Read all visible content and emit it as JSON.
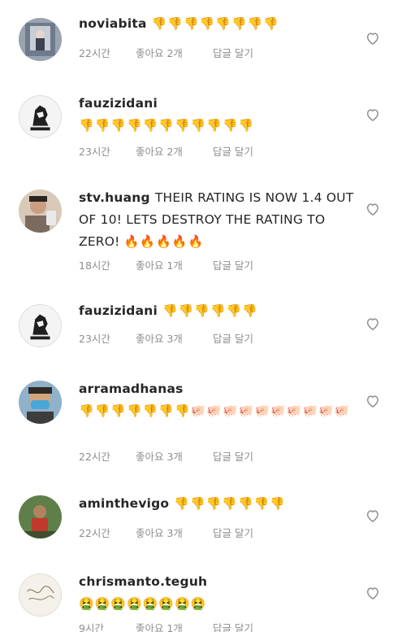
{
  "colors": {
    "text": "#262626",
    "meta": "#8e8e8e",
    "heart": "#8e8e8e"
  },
  "comments": [
    {
      "username": "noviabita",
      "text": "",
      "emoji": "👎👎👎👎👎👎👎👎",
      "time": "22시간",
      "likes": "좋아요 2개",
      "reply": "답글 달기"
    },
    {
      "username": "fauzizidani",
      "text": "",
      "emoji": "👎👎👎👎👎👎👎👎👎👎👎",
      "time": "23시간",
      "likes": "좋아요 2개",
      "reply": "답글 달기"
    },
    {
      "username": "stv.huang",
      "text": "THEIR RATING IS NOW 1.4 OUT OF 10! LETS DESTROY THE RATING TO ZERO!",
      "emoji": "🔥🔥🔥🔥🔥",
      "time": "18시간",
      "likes": "좋아요 1개",
      "reply": "답글 달기"
    },
    {
      "username": "fauzizidani",
      "text": "",
      "emoji": "👎👎👎👎👎👎",
      "time": "23시간",
      "likes": "좋아요 3개",
      "reply": "답글 달기"
    },
    {
      "username": "arramadhanas",
      "text": "",
      "emoji": "👎👎👎👎👎👎👎🐖🐖🐖🐖🐖🐖🐖🐖🐖🐖",
      "time": "22시간",
      "likes": "좋아요 3개",
      "reply": "답글 달기"
    },
    {
      "username": "aminthevigo",
      "text": "",
      "emoji": "👎👎👎👎👎👎👎",
      "time": "22시간",
      "likes": "좋아요 3개",
      "reply": "답글 달기"
    },
    {
      "username": "chrismanto.teguh",
      "text": "",
      "emoji": "🤮🤮🤮🤮🤮🤮🤮🤮",
      "time": "9시간",
      "likes": "좋아요 1개",
      "reply": "답글 달기"
    }
  ]
}
